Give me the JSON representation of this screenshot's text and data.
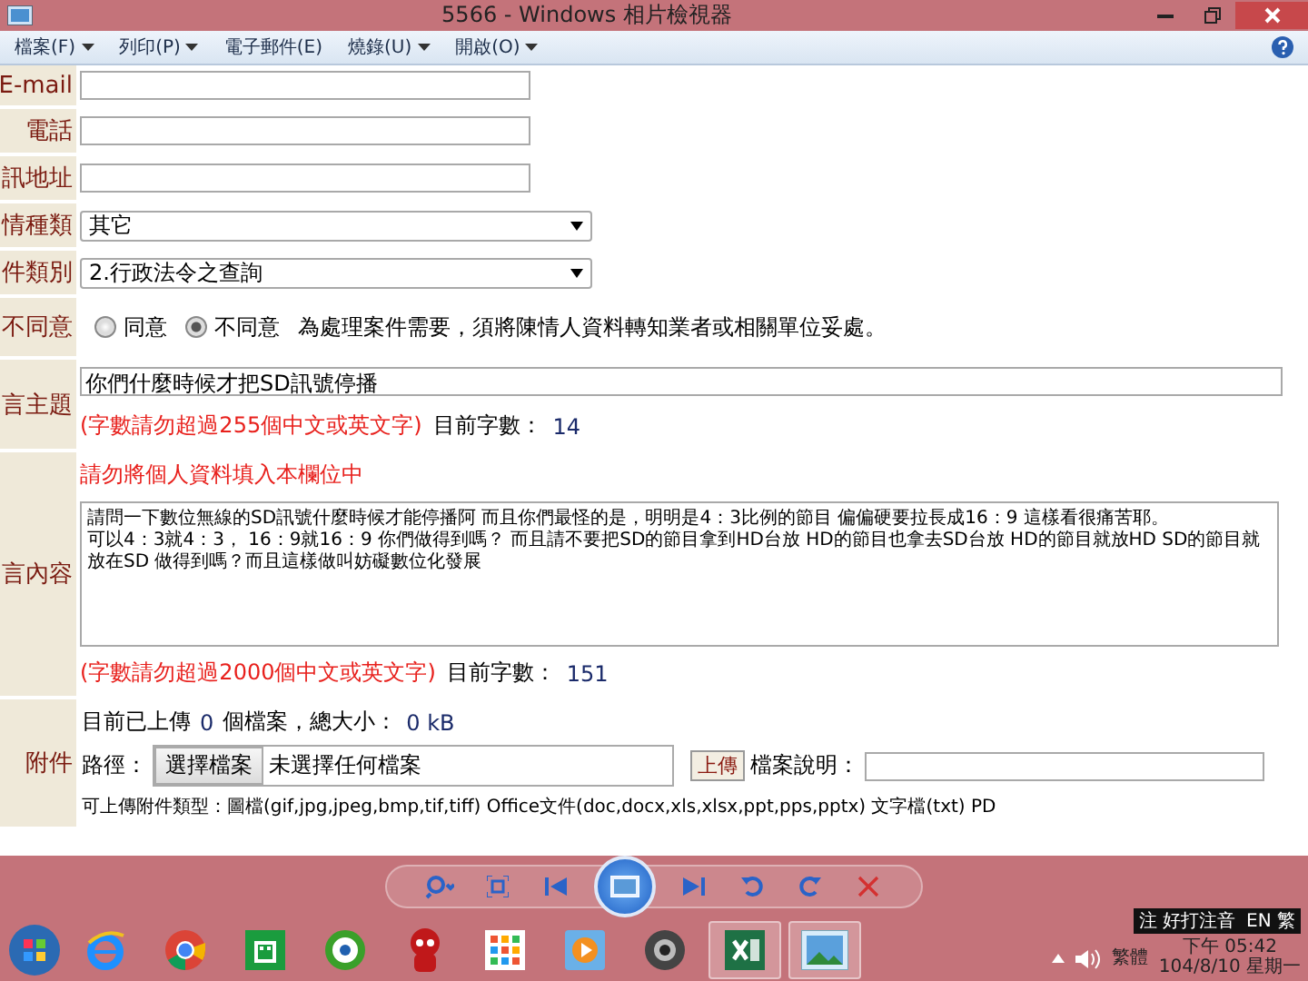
{
  "window": {
    "title": "5566 - Windows 相片檢視器"
  },
  "menu": [
    {
      "label": "檔案(F)",
      "dropdown": true
    },
    {
      "label": "列印(P)",
      "dropdown": true
    },
    {
      "label": "電子郵件(E)",
      "dropdown": false
    },
    {
      "label": "燒錄(U)",
      "dropdown": true
    },
    {
      "label": "開啟(O)",
      "dropdown": true
    }
  ],
  "form": {
    "contact_rows": [
      {
        "label": "E-mail",
        "value": ""
      },
      {
        "label": "電話",
        "value": ""
      },
      {
        "label": "訊地址",
        "value": ""
      }
    ],
    "select_rows": [
      {
        "label": "情種類",
        "value": "其它"
      },
      {
        "label": "件類別",
        "value": "2.行政法令之查詢"
      }
    ],
    "consent": {
      "label": "不同意",
      "options": [
        {
          "label": "同意",
          "selected": false
        },
        {
          "label": "不同意",
          "selected": true
        }
      ],
      "note": "為處理案件需要，須將陳情人資料轉知業者或相關單位妥處。"
    },
    "subject": {
      "label": "言主題",
      "value": "你們什麼時候才把SD訊號停播",
      "limit": "(字數請勿超過255個中文或英文字)",
      "count_label": "目前字數：",
      "count": "14"
    },
    "content": {
      "label": "言內容",
      "warning": "請勿將個人資料填入本欄位中",
      "lines": [
        "請問一下數位無線的SD訊號什麼時候才能停播阿 而且你們最怪的是，明明是4：3比例的節目 偏偏硬要拉長成16：9 這樣看很痛苦耶。",
        "可以4：3就4：3， 16：9就16：9 你們做得到嗎？ 而且請不要把SD的節目拿到HD台放 HD的節目也拿去SD台放 HD的節目就放HD SD的節目就放在SD 做得到嗎？而且這樣做叫妨礙數位化發展"
      ],
      "limit": "(字數請勿超過2000個中文或英文字)",
      "count_label": "目前字數：",
      "count": "151"
    },
    "attachment": {
      "label": "附件",
      "uploaded_prefix": "目前已上傳",
      "uploaded_count": "0",
      "uploaded_mid": "個檔案，總大小：",
      "uploaded_size": "0 kB",
      "path_label": "路徑：",
      "choose_button": "選擇檔案",
      "no_file": "未選擇任何檔案",
      "upload_button": "上傳",
      "desc_label": "檔案說明：",
      "types_line": "可上傳附件類型：圖檔(gif,jpg,jpeg,bmp,tif,tiff) Office文件(doc,docx,xls,xlsx,ppt,pps,pptx) 文字檔(txt) PD"
    }
  },
  "viewer_controls": [
    {
      "kind": "zoom"
    },
    {
      "kind": "fit"
    },
    {
      "kind": "prev"
    },
    {
      "kind": "slideshow"
    },
    {
      "kind": "next"
    },
    {
      "kind": "rotate-left"
    },
    {
      "kind": "rotate-right"
    },
    {
      "kind": "delete"
    }
  ],
  "taskbar": {
    "apps": [
      {
        "kind": "ie",
        "active": false
      },
      {
        "kind": "chrome",
        "active": false
      },
      {
        "kind": "store",
        "active": false
      },
      {
        "kind": "ring",
        "active": false
      },
      {
        "kind": "mascot",
        "active": false
      },
      {
        "kind": "tiles",
        "active": false
      },
      {
        "kind": "player",
        "active": false
      },
      {
        "kind": "camera",
        "active": false
      },
      {
        "kind": "excel",
        "active": true
      },
      {
        "kind": "photos",
        "active": true
      }
    ],
    "ime": "注 好打注音",
    "ime_lang": "EN 繁",
    "tray_lang": "繁體",
    "time": "下午 05:42",
    "date": "104/8/10 星期一"
  }
}
